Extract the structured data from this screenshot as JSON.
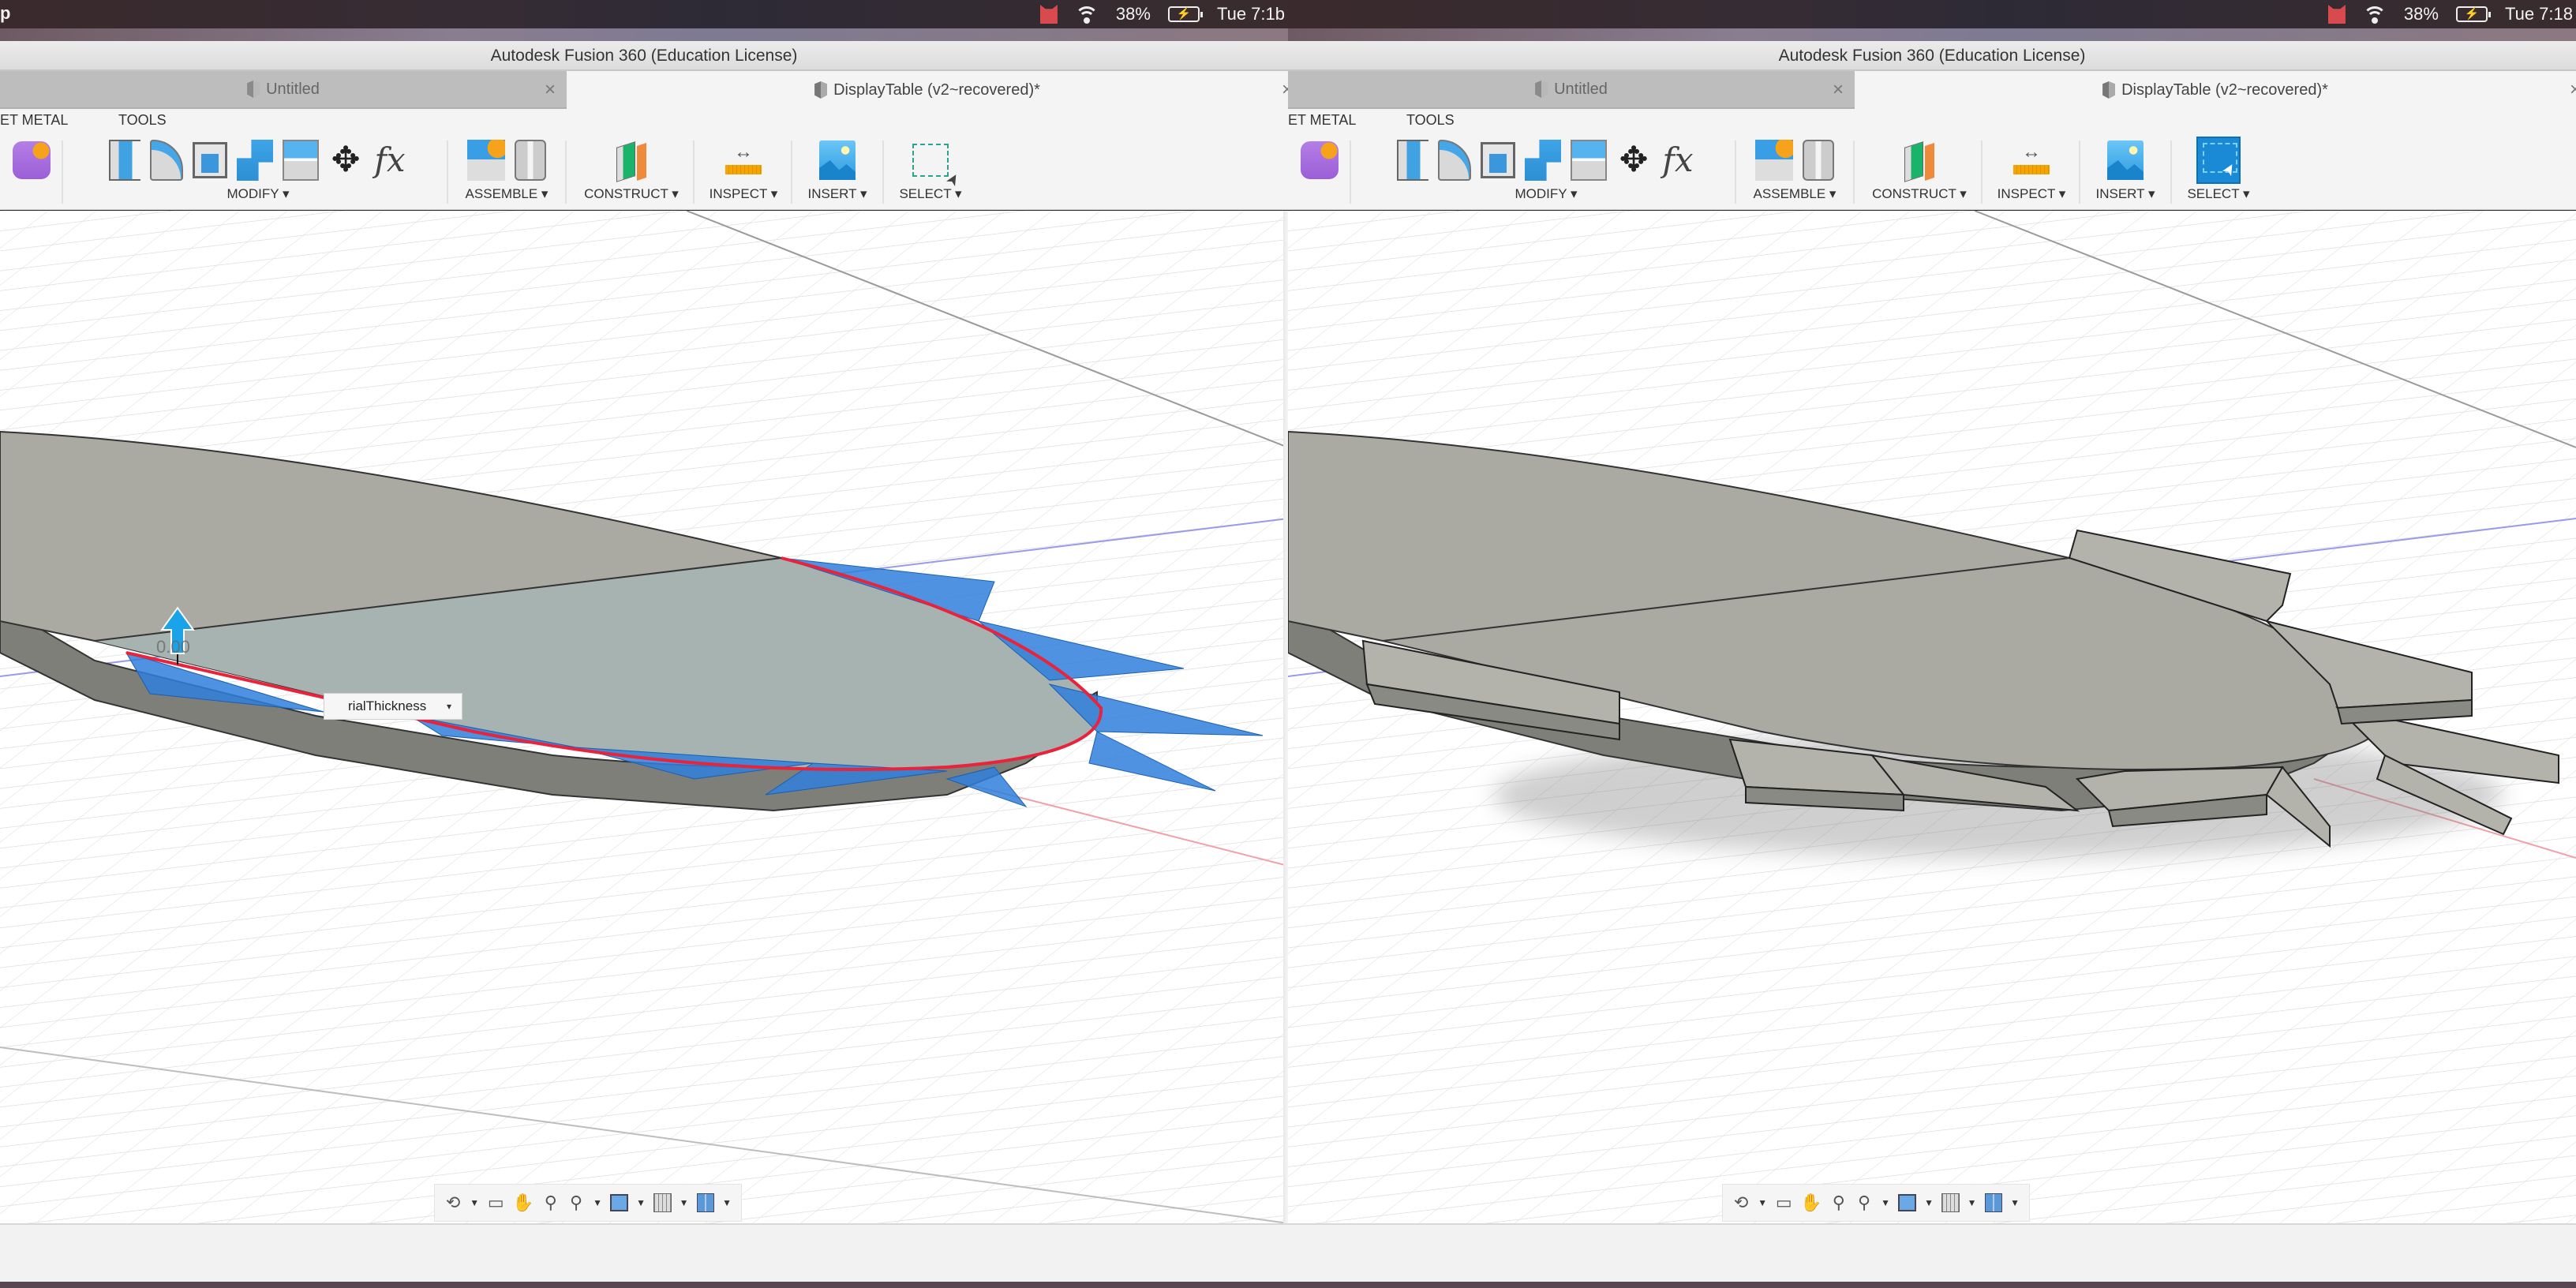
{
  "screens": [
    {
      "id": "left",
      "menubar": {
        "app_fragment": "p",
        "battery": "38%",
        "clock": "Tue 7:1b"
      },
      "window_title": "Autodesk Fusion 360 (Education License)",
      "tabs": [
        {
          "label": "Untitled",
          "active": false,
          "close": "×"
        },
        {
          "label": "DisplayTable (v2~recovered)*",
          "active": true,
          "close": "×"
        }
      ],
      "workspace_tabs": [
        "ET METAL",
        "TOOLS"
      ],
      "toolbar_groups": {
        "modify": "MODIFY ▾",
        "assemble": "ASSEMBLE ▾",
        "construct": "CONSTRUCT ▾",
        "inspect": "INSPECT ▾",
        "insert": "INSERT ▾",
        "select": "SELECT ▾"
      },
      "select_tool_active": false,
      "param_input": {
        "value": "rialThickness",
        "dropdown": "▾"
      },
      "distance_label": "0.00",
      "mode": "flange-preview"
    },
    {
      "id": "right",
      "menubar": {
        "app_fragment": "",
        "battery": "38%",
        "clock": "Tue 7:18"
      },
      "window_title": "Autodesk Fusion 360 (Education License)",
      "tabs": [
        {
          "label": "Untitled",
          "active": false,
          "close": "×"
        },
        {
          "label": "DisplayTable (v2~recovered)*",
          "active": true,
          "close": "×"
        }
      ],
      "workspace_tabs": [
        "ET METAL",
        "TOOLS"
      ],
      "toolbar_groups": {
        "modify": "MODIFY ▾",
        "assemble": "ASSEMBLE ▾",
        "construct": "CONSTRUCT ▾",
        "inspect": "INSPECT ▾",
        "insert": "INSERT ▾",
        "select": "SELECT ▾"
      },
      "select_tool_active": true,
      "mode": "flange-result"
    }
  ],
  "icons": {
    "toolbar": [
      "sheet-metal-create-icon",
      "press-pull-icon",
      "fillet-icon",
      "shell-icon",
      "combine-icon",
      "split-face-icon",
      "move-icon",
      "parameters-fx-icon",
      "new-component-icon",
      "joint-icon",
      "offset-plane-icon",
      "measure-icon",
      "insert-image-icon",
      "select-window-icon"
    ],
    "navbar": [
      "orbit-icon",
      "look-at-icon",
      "pan-hand-icon",
      "zoom-icon",
      "fit-zoom-icon",
      "display-settings-icon",
      "grid-settings-icon",
      "viewports-icon"
    ]
  },
  "colors": {
    "selection_blue": "#2f7fdc",
    "edge_red": "#e8243c",
    "body_gray": "#a9a9a2",
    "grid_line": "#e3e3e3"
  },
  "fx_glyph": "fx",
  "move_glyph": "✥",
  "nav_glyphs": {
    "orbit": "⟲",
    "pan": "✋",
    "zoom": "🔍",
    "caret": "▼"
  }
}
